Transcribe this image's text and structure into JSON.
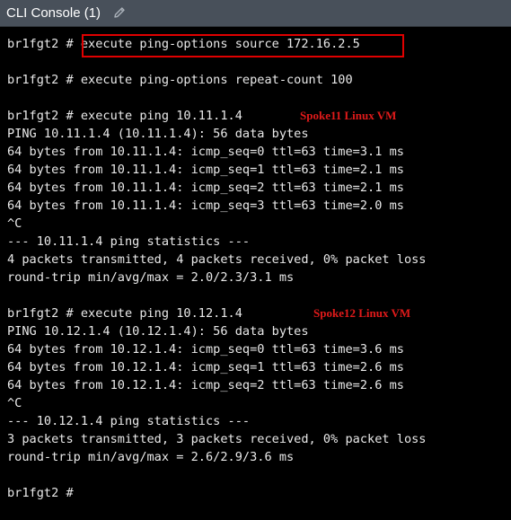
{
  "window": {
    "title": "CLI Console (1)",
    "edit_icon": "pencil-icon"
  },
  "console": {
    "lines": [
      "br1fgt2 # execute ping-options source 172.16.2.5",
      "",
      "br1fgt2 # execute ping-options repeat-count 100",
      "",
      "br1fgt2 # execute ping 10.11.1.4",
      "PING 10.11.1.4 (10.11.1.4): 56 data bytes",
      "64 bytes from 10.11.1.4: icmp_seq=0 ttl=63 time=3.1 ms",
      "64 bytes from 10.11.1.4: icmp_seq=1 ttl=63 time=2.1 ms",
      "64 bytes from 10.11.1.4: icmp_seq=2 ttl=63 time=2.1 ms",
      "64 bytes from 10.11.1.4: icmp_seq=3 ttl=63 time=2.0 ms",
      "^C",
      "--- 10.11.1.4 ping statistics ---",
      "4 packets transmitted, 4 packets received, 0% packet loss",
      "round-trip min/avg/max = 2.0/2.3/3.1 ms",
      "",
      "br1fgt2 # execute ping 10.12.1.4",
      "PING 10.12.1.4 (10.12.1.4): 56 data bytes",
      "64 bytes from 10.12.1.4: icmp_seq=0 ttl=63 time=3.6 ms",
      "64 bytes from 10.12.1.4: icmp_seq=1 ttl=63 time=2.6 ms",
      "64 bytes from 10.12.1.4: icmp_seq=2 ttl=63 time=2.6 ms",
      "^C",
      "--- 10.12.1.4 ping statistics ---",
      "3 packets transmitted, 3 packets received, 0% packet loss",
      "round-trip min/avg/max = 2.6/2.9/3.6 ms",
      "",
      "br1fgt2 #"
    ]
  },
  "annotations": {
    "spoke11": "Spoke11  Linux  VM",
    "spoke12": "Spoke12  Linux  VM"
  },
  "colors": {
    "titlebar_bg": "#48505a",
    "console_bg": "#000000",
    "console_text": "#e9e9e9",
    "highlight_box": "#e00000",
    "annotation_text": "#e01a1a"
  }
}
